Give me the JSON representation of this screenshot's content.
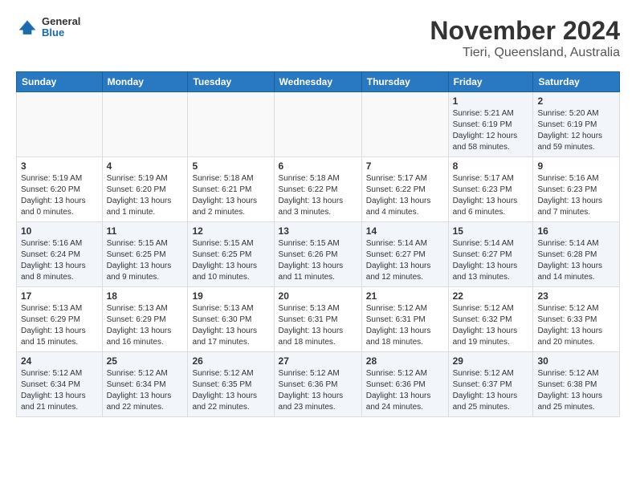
{
  "logo": {
    "general": "General",
    "blue": "Blue"
  },
  "header": {
    "month": "November 2024",
    "location": "Tieri, Queensland, Australia"
  },
  "weekdays": [
    "Sunday",
    "Monday",
    "Tuesday",
    "Wednesday",
    "Thursday",
    "Friday",
    "Saturday"
  ],
  "weeks": [
    [
      {
        "day": "",
        "info": ""
      },
      {
        "day": "",
        "info": ""
      },
      {
        "day": "",
        "info": ""
      },
      {
        "day": "",
        "info": ""
      },
      {
        "day": "",
        "info": ""
      },
      {
        "day": "1",
        "info": "Sunrise: 5:21 AM\nSunset: 6:19 PM\nDaylight: 12 hours\nand 58 minutes."
      },
      {
        "day": "2",
        "info": "Sunrise: 5:20 AM\nSunset: 6:19 PM\nDaylight: 12 hours\nand 59 minutes."
      }
    ],
    [
      {
        "day": "3",
        "info": "Sunrise: 5:19 AM\nSunset: 6:20 PM\nDaylight: 13 hours\nand 0 minutes."
      },
      {
        "day": "4",
        "info": "Sunrise: 5:19 AM\nSunset: 6:20 PM\nDaylight: 13 hours\nand 1 minute."
      },
      {
        "day": "5",
        "info": "Sunrise: 5:18 AM\nSunset: 6:21 PM\nDaylight: 13 hours\nand 2 minutes."
      },
      {
        "day": "6",
        "info": "Sunrise: 5:18 AM\nSunset: 6:22 PM\nDaylight: 13 hours\nand 3 minutes."
      },
      {
        "day": "7",
        "info": "Sunrise: 5:17 AM\nSunset: 6:22 PM\nDaylight: 13 hours\nand 4 minutes."
      },
      {
        "day": "8",
        "info": "Sunrise: 5:17 AM\nSunset: 6:23 PM\nDaylight: 13 hours\nand 6 minutes."
      },
      {
        "day": "9",
        "info": "Sunrise: 5:16 AM\nSunset: 6:23 PM\nDaylight: 13 hours\nand 7 minutes."
      }
    ],
    [
      {
        "day": "10",
        "info": "Sunrise: 5:16 AM\nSunset: 6:24 PM\nDaylight: 13 hours\nand 8 minutes."
      },
      {
        "day": "11",
        "info": "Sunrise: 5:15 AM\nSunset: 6:25 PM\nDaylight: 13 hours\nand 9 minutes."
      },
      {
        "day": "12",
        "info": "Sunrise: 5:15 AM\nSunset: 6:25 PM\nDaylight: 13 hours\nand 10 minutes."
      },
      {
        "day": "13",
        "info": "Sunrise: 5:15 AM\nSunset: 6:26 PM\nDaylight: 13 hours\nand 11 minutes."
      },
      {
        "day": "14",
        "info": "Sunrise: 5:14 AM\nSunset: 6:27 PM\nDaylight: 13 hours\nand 12 minutes."
      },
      {
        "day": "15",
        "info": "Sunrise: 5:14 AM\nSunset: 6:27 PM\nDaylight: 13 hours\nand 13 minutes."
      },
      {
        "day": "16",
        "info": "Sunrise: 5:14 AM\nSunset: 6:28 PM\nDaylight: 13 hours\nand 14 minutes."
      }
    ],
    [
      {
        "day": "17",
        "info": "Sunrise: 5:13 AM\nSunset: 6:29 PM\nDaylight: 13 hours\nand 15 minutes."
      },
      {
        "day": "18",
        "info": "Sunrise: 5:13 AM\nSunset: 6:29 PM\nDaylight: 13 hours\nand 16 minutes."
      },
      {
        "day": "19",
        "info": "Sunrise: 5:13 AM\nSunset: 6:30 PM\nDaylight: 13 hours\nand 17 minutes."
      },
      {
        "day": "20",
        "info": "Sunrise: 5:13 AM\nSunset: 6:31 PM\nDaylight: 13 hours\nand 18 minutes."
      },
      {
        "day": "21",
        "info": "Sunrise: 5:12 AM\nSunset: 6:31 PM\nDaylight: 13 hours\nand 18 minutes."
      },
      {
        "day": "22",
        "info": "Sunrise: 5:12 AM\nSunset: 6:32 PM\nDaylight: 13 hours\nand 19 minutes."
      },
      {
        "day": "23",
        "info": "Sunrise: 5:12 AM\nSunset: 6:33 PM\nDaylight: 13 hours\nand 20 minutes."
      }
    ],
    [
      {
        "day": "24",
        "info": "Sunrise: 5:12 AM\nSunset: 6:34 PM\nDaylight: 13 hours\nand 21 minutes."
      },
      {
        "day": "25",
        "info": "Sunrise: 5:12 AM\nSunset: 6:34 PM\nDaylight: 13 hours\nand 22 minutes."
      },
      {
        "day": "26",
        "info": "Sunrise: 5:12 AM\nSunset: 6:35 PM\nDaylight: 13 hours\nand 22 minutes."
      },
      {
        "day": "27",
        "info": "Sunrise: 5:12 AM\nSunset: 6:36 PM\nDaylight: 13 hours\nand 23 minutes."
      },
      {
        "day": "28",
        "info": "Sunrise: 5:12 AM\nSunset: 6:36 PM\nDaylight: 13 hours\nand 24 minutes."
      },
      {
        "day": "29",
        "info": "Sunrise: 5:12 AM\nSunset: 6:37 PM\nDaylight: 13 hours\nand 25 minutes."
      },
      {
        "day": "30",
        "info": "Sunrise: 5:12 AM\nSunset: 6:38 PM\nDaylight: 13 hours\nand 25 minutes."
      }
    ]
  ]
}
